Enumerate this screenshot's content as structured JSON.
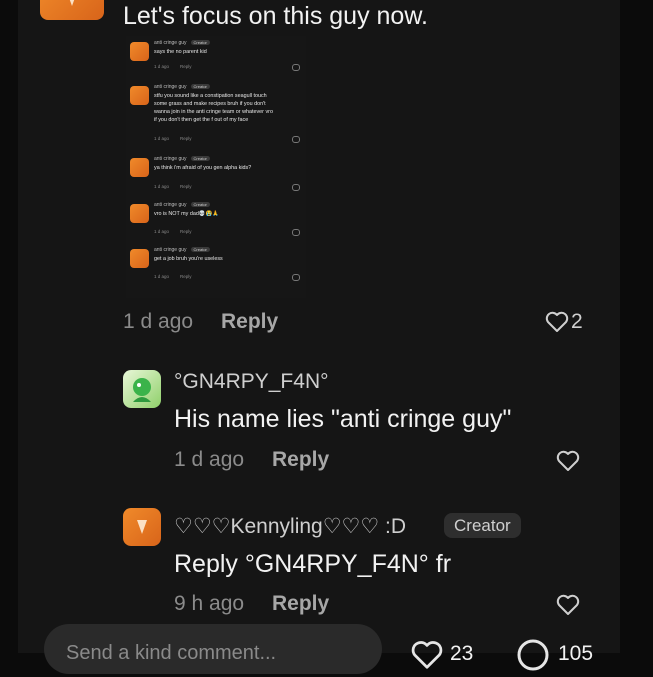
{
  "top": {
    "text": "Let's focus on this guy now."
  },
  "embedded": {
    "comments": [
      {
        "name": "anti cringe guy",
        "badge": "Creator",
        "text": "says the no parent kid",
        "time": "1 d ago",
        "reply": "Reply"
      },
      {
        "name": "anti cringe guy",
        "badge": "Creator",
        "text": "stfu you sound like a constipation seagull touch\nsome grass and make recipes bruh if you don't\nwanna join in the anti cringe team or whatever vro\nif you don't then get the f out of my face",
        "time": "1 d ago",
        "reply": "Reply"
      },
      {
        "name": "anti cringe guy",
        "badge": "Creator",
        "text": "ya think i'm afraid of you gen alpha kids?",
        "time": "1 d ago",
        "reply": "Reply"
      },
      {
        "name": "anti cringe guy",
        "badge": "Creator",
        "text": "vro is NOT my dad💀😭🙏",
        "time": "1 d ago",
        "reply": "Reply"
      },
      {
        "name": "anti cringe guy",
        "badge": "Creator",
        "text": "get a job bruh you're useless",
        "time": "1 d ago",
        "reply": "Reply"
      }
    ]
  },
  "comment_meta": {
    "time": "1 d ago",
    "reply": "Reply",
    "likes": "2"
  },
  "reply1": {
    "username": "°GN4RPY_F4N°",
    "text": "His name lies \"anti cringe guy\"",
    "time": "1 d ago",
    "reply": "Reply"
  },
  "reply2": {
    "username": "♡♡♡Kennyling♡♡♡ :D",
    "badge": "Creator",
    "text": "Reply °GN4RPY_F4N° fr",
    "time": "9 h ago",
    "reply": "Reply"
  },
  "bottom": {
    "placeholder": "Send a kind comment...",
    "likes": "23",
    "comments": "105"
  },
  "colors": {
    "accent": "#e8782a",
    "background": "#151515",
    "muted": "#8b8b8b"
  }
}
